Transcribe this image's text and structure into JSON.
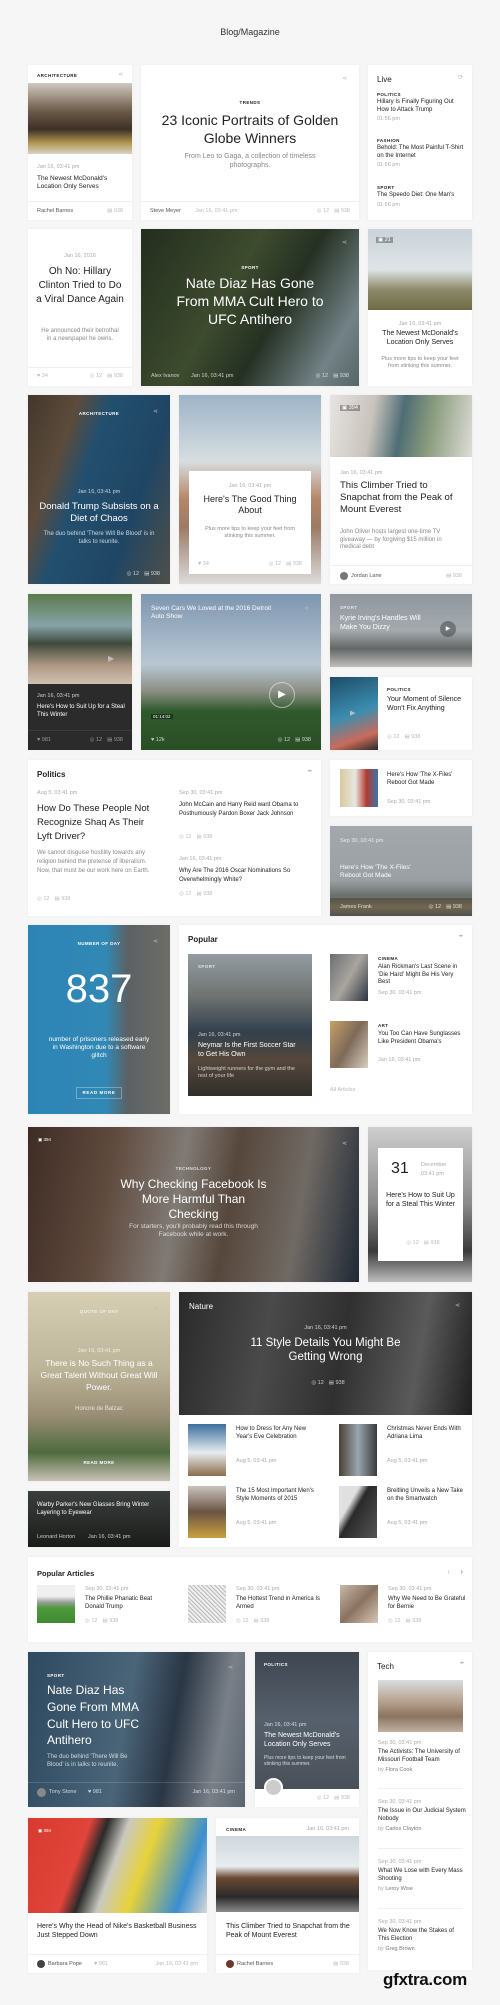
{
  "page_title": "Blog/Magazine",
  "colors": {
    "background": "#f6f6f6",
    "card": "#ffffff",
    "number_card": "#2f86b5",
    "dark_panel": "#2b2b2b"
  },
  "r1": {
    "c1": {
      "category": "ARCHITECTURE",
      "date": "Jan 16, 03:41 pm",
      "title": "The Newest McDonald's Location Only Serves",
      "author": "Rachel Barnes",
      "comments": "938"
    },
    "c2": {
      "category": "TRENDS",
      "title": "23 Iconic Portraits of Golden Globe Winners",
      "subtitle": "From Leo to Gaga, a collection of timeless photographs.",
      "author": "Steve Meyer",
      "date": "Jan 16, 03:41 pm",
      "views": "12",
      "comments": "938"
    },
    "live": {
      "title": "Live",
      "items": [
        {
          "category": "POLITICS",
          "title": "Hillary Is Finally Figuring Out How to Attack Trump",
          "time": "01:56 pm"
        },
        {
          "category": "FASHION",
          "title": "Behold: The Most Painful T-Shirt on the Internet",
          "time": "01:56 pm"
        },
        {
          "category": "SPORT",
          "title": "The Speedo Diet: One Man's",
          "time": "01:56 pm"
        }
      ]
    }
  },
  "r2": {
    "c4": {
      "date": "Jan 16, 2016",
      "title": "Oh No: Hillary Clinton Tried to Do a Viral Dance Again",
      "desc": "He announced their betrothal in a newspaper he owns.",
      "likes": "34",
      "views": "12",
      "comments": "938"
    },
    "c5": {
      "category": "SPORT",
      "title": "Nate Diaz Has Gone From MMA Cult Hero to UFC Antihero",
      "author": "Alex Ivanov",
      "date": "Jan 16, 03:41 pm",
      "views": "12",
      "comments": "938"
    },
    "c6": {
      "photos": "21",
      "date": "Jan 16, 03:41 pm",
      "title": "The Newest McDonald's Location Only Serves",
      "desc": "Plus more tips to keep your feet from stinking this summer."
    }
  },
  "r3": {
    "c7": {
      "category": "ARCHITECTURE",
      "date": "Jan 16, 03:41 pm",
      "title": "Donald Trump Subsists on a Diet of Chaos",
      "desc": "The duo behind 'There Will Be Blood' is in talks to reunite.",
      "views": "12",
      "comments": "938"
    },
    "c8": {
      "date": "Jan 16, 03:41 pm",
      "title": "Here's The Good Thing About",
      "desc": "Plus more tips to keep your feet from stinking this summer.",
      "likes": "34",
      "views": "12",
      "comments": "938"
    },
    "c9": {
      "photos": "394",
      "date": "Jan 16, 03:41 pm",
      "title": "This Climber Tried to Snapchat from the Peak of Mount Everest",
      "desc": "John Oliver hosts largest one-time TV giveaway — by forgiving $15 million in medical debt",
      "author": "Jordan Lane",
      "comments": "938"
    }
  },
  "r4": {
    "c10": {
      "date": "Jan 16, 03:41 pm",
      "title": "Here's How to Suit Up for a Steal This Winter",
      "likes": "981",
      "views": "12",
      "comments": "938"
    },
    "c11": {
      "title": "Seven Cars We Loved at the 2016 Detroit Auto Show",
      "duration": "01:14:02",
      "likes": "12k",
      "views": "12",
      "comments": "938"
    },
    "c12": {
      "category": "SPORT",
      "title": "Kyrie Irving's Handles Will Make You Dizzy"
    },
    "c13": {
      "category": "POLITICS",
      "title": "Your Moment of Silence Won't Fix Anything",
      "views": "12",
      "comments": "938"
    }
  },
  "politics": {
    "title": "Politics",
    "main": {
      "date": "Aug 5, 03:41 pm",
      "title": "How Do These People Not Recognize Shaq As Their Lyft Driver?",
      "desc": "We cannot disguise hostility towards any religion behind the pretense of liberalism. Now, that must be our work here on Earth.",
      "views": "12",
      "comments": "938"
    },
    "items": [
      {
        "date": "Sep 30, 03:41 pm",
        "title": "John McCain and Harry Reid want Obama to Posthumously Pardon Boxer Jack Johnson",
        "views": "12",
        "comments": "938"
      },
      {
        "date": "Jan 16, 03:41 pm",
        "title": "Why Are The 2016 Oscar Nominations So Overwhelmingly White?",
        "views": "12",
        "comments": "938"
      }
    ]
  },
  "c14": {
    "title": "Here's How 'The X-Files' Reboot Got Made",
    "date": "Sep 30, 03:41 pm"
  },
  "c15": {
    "date": "Sep 30, 03:41 pm",
    "title": "Here's How 'The X-Files' Reboot Got Made",
    "author": "James Frank",
    "views": "12",
    "comments": "938"
  },
  "number": {
    "label": "NUMBER OF DAY",
    "value": "837",
    "desc": "number of prisoners released early in Washington due to a software glitch",
    "button": "READ MORE"
  },
  "popular": {
    "title": "Popular",
    "feature": {
      "category": "SPORT",
      "date": "Jan 16, 03:41 pm",
      "title": "Neymar Is the First Soccer Star to Get His Own",
      "desc": "Lightweight runners for the gym and the rest of your life"
    },
    "items": [
      {
        "category": "CINEMA",
        "title": "Alan Rickman's Last Scene in 'Die Hard' Might Be His Very Best",
        "date": "Sep 30, 03:41 pm"
      },
      {
        "category": "ART",
        "title": "You Too Can Have Sunglasses Like President Obama's",
        "date": "Jan 16, 03:41 pm"
      }
    ],
    "all_link": "All Articles"
  },
  "c17": {
    "photos": "394",
    "category": "TECHNOLOGY",
    "title": "Why Checking Facebook Is More Harmful Than Checking",
    "desc": "For starters, you'll probably read this through Facebook while at work."
  },
  "c18": {
    "day": "31",
    "month": "December",
    "time": "03:41 pm",
    "title": "Here's How to Suit Up for a Steal This Winter",
    "views": "12",
    "comments": "938"
  },
  "quote": {
    "label": "QUOTE OF DAY",
    "date": "Jan 16, 03:41 pm",
    "text": "There is No Such Thing as a Great Talent Without Great Will Power.",
    "author": "Honore de Balzac",
    "button": "READ MORE"
  },
  "nature": {
    "title": "Nature",
    "date": "Jan 16, 03:41 pm",
    "headline": "11 Style Details You Might Be Getting Wrong",
    "views": "12",
    "comments": "938",
    "items": [
      {
        "title": "How to Dress for Any New Year's Eve Celebration",
        "date": "Aug 5, 03:41 pm"
      },
      {
        "title": "Christmas Never Ends With Adriana Lima",
        "date": "Aug 5, 03:41 pm"
      },
      {
        "title": "The 15 Most Important Men's Style Moments of 2015",
        "date": "Aug 5, 03:41 pm"
      },
      {
        "title": "Breitling Unveils a New Take on the Smartwatch",
        "date": "Aug 5, 03:41 pm"
      }
    ]
  },
  "c20": {
    "title": "Warby Parker's New Glasses Bring Winter Layering to Eyewear",
    "author": "Leonard Horton",
    "date": "Jan 16, 03:41 pm"
  },
  "popular_articles": {
    "title": "Popular Articles",
    "items": [
      {
        "date": "Sep 30, 03:41 pm",
        "title": "The Phillie Phanatic Beat Donald Trump",
        "views": "12",
        "comments": "938"
      },
      {
        "date": "Sep 30, 03:41 pm",
        "title": "The Hottest Trend in America Is Armed",
        "views": "12",
        "comments": "938"
      },
      {
        "date": "Sep 30, 03:41 pm",
        "title": "Why We Need to Be Grateful for Bernie",
        "views": "12",
        "comments": "938"
      }
    ]
  },
  "c21": {
    "category": "SPORT",
    "title": "Nate Diaz Has Gone From MMA Cult Hero to UFC Antihero",
    "desc": "The duo behind 'There Will Be Blood' is in talks to reunite.",
    "author": "Tony Stone",
    "likes": "981",
    "date": "Jan 16, 03:41 pm"
  },
  "c22": {
    "category": "POLITICS",
    "date": "Jan 16, 03:41 pm",
    "title": "The Newest McDonald's Location Only Serves",
    "desc": "Plus more tips to keep your feet from stinking this summer.",
    "views": "12",
    "comments": "938"
  },
  "tech": {
    "title": "Tech",
    "items": [
      {
        "date": "Sep 30, 03:41 pm",
        "title": "The Activists: The University of Missouri Football Team",
        "by": "by",
        "author": "Flora Cook"
      },
      {
        "date": "Sep 30, 03:41 pm",
        "title": "The Issue in Our Judicial System Nobody",
        "by": "by",
        "author": "Carlos Clayton"
      },
      {
        "date": "Sep 30, 03:41 pm",
        "title": "What We Lose with Every Mass Shooting",
        "by": "by",
        "author": "Leroy Wise"
      },
      {
        "date": "Sep 30, 03:41 pm",
        "title": "We Now Know the Stakes of This Election",
        "by": "by",
        "author": "Greg Brown"
      }
    ]
  },
  "c23": {
    "photos": "394",
    "title": "Here's Why the Head of Nike's Basketball Business Just Stepped Down",
    "author": "Barbara Pope",
    "likes": "981",
    "date": "Jan 16, 03:41 pm"
  },
  "c24": {
    "category": "CINEMA",
    "date": "Jan 16, 03:41 pm",
    "title": "This Climber Tried to Snapchat from the Peak of Mount Everest",
    "author": "Rachel Barnes",
    "comments": "938"
  },
  "watermark": "gfxtra.com"
}
